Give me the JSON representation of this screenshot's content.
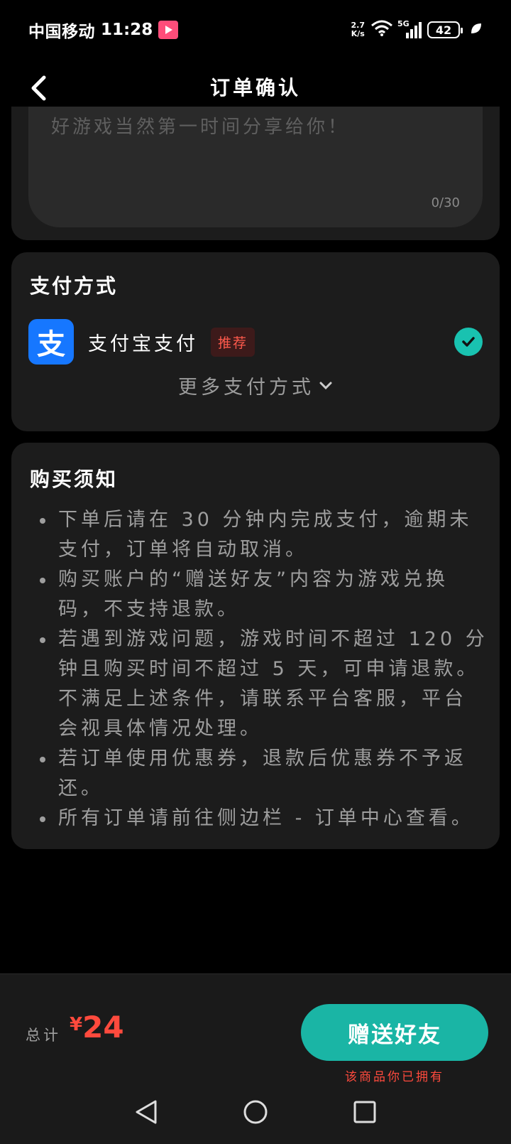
{
  "status_bar": {
    "carrier": "中国移动",
    "time": "11:28",
    "net_speed_value": "2.7",
    "net_speed_unit": "K/s",
    "network": "5G",
    "battery": "42"
  },
  "nav": {
    "title": "订单确认"
  },
  "message": {
    "placeholder": "好游戏当然第一时间分享给你！",
    "counter": "0/30"
  },
  "payment": {
    "title": "支付方式",
    "method_label": "支付宝支付",
    "alipay_logo": "支",
    "recommend_badge": "推荐",
    "more_label": "更多支付方式"
  },
  "notice": {
    "title": "购买须知",
    "items": [
      "下单后请在 30 分钟内完成支付，逾期未支付，订单将自动取消。",
      "购买账户的“赠送好友”内容为游戏兑换码，不支持退款。",
      "若遇到游戏问题，游戏时间不超过 120 分钟且购买时间不超过 5 天，可申请退款。不满足上述条件，请联系平台客服，平台会视具体情况处理。",
      "若订单使用优惠券，退款后优惠券不予返还。",
      "所有订单请前往侧边栏 - 订单中心查看。"
    ]
  },
  "footer": {
    "total_label": "总计",
    "currency": "¥",
    "amount": "24",
    "gift_button": "赠送好友",
    "owned_note": "该商品你已拥有"
  },
  "colors": {
    "accent": "#1ab5a5",
    "price": "#ff4a3d",
    "alipay": "#1677ff"
  },
  "icons": [
    "play-badge-icon",
    "wifi-icon",
    "signal-icon",
    "battery-icon",
    "leaf-icon",
    "back-arrow-icon",
    "check-icon",
    "chevron-down-icon",
    "nav-back-icon",
    "nav-home-icon",
    "nav-recents-icon"
  ]
}
